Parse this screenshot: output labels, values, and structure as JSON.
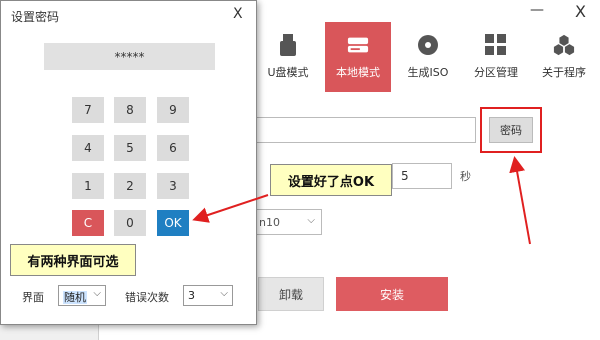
{
  "dialog": {
    "title": "设置密码",
    "close_glyph": "X",
    "password_mask": "*****",
    "keypad": [
      "7",
      "8",
      "9",
      "4",
      "5",
      "6",
      "1",
      "2",
      "3",
      "C",
      "0",
      "OK"
    ],
    "interface_label": "界面",
    "interface_value": "随机",
    "error_count_label": "错误次数",
    "error_count_value": "3"
  },
  "main": {
    "minimize_glyph": "—",
    "close_glyph": "X",
    "toolbar": [
      {
        "label": "U盘模式",
        "icon": "usb-icon"
      },
      {
        "label": "本地模式",
        "icon": "hard-drive-icon"
      },
      {
        "label": "生成ISO",
        "icon": "disc-icon"
      },
      {
        "label": "分区管理",
        "icon": "partition-grid-icon"
      },
      {
        "label": "关于程序",
        "icon": "hexagons-icon"
      }
    ],
    "password_button": "密码",
    "seconds_value": "5",
    "seconds_unit": "秒",
    "os_select_value": "n10",
    "uninstall_label": "卸载",
    "install_label": "安装"
  },
  "annotations": {
    "note_interfaces": "有两种界面可选",
    "note_ok": "设置好了点OK"
  },
  "colors": {
    "accent_red": "#d9565a",
    "ok_blue": "#1f7fc2",
    "arrow_red": "#e02020",
    "note_yellow": "#ffffc0"
  }
}
